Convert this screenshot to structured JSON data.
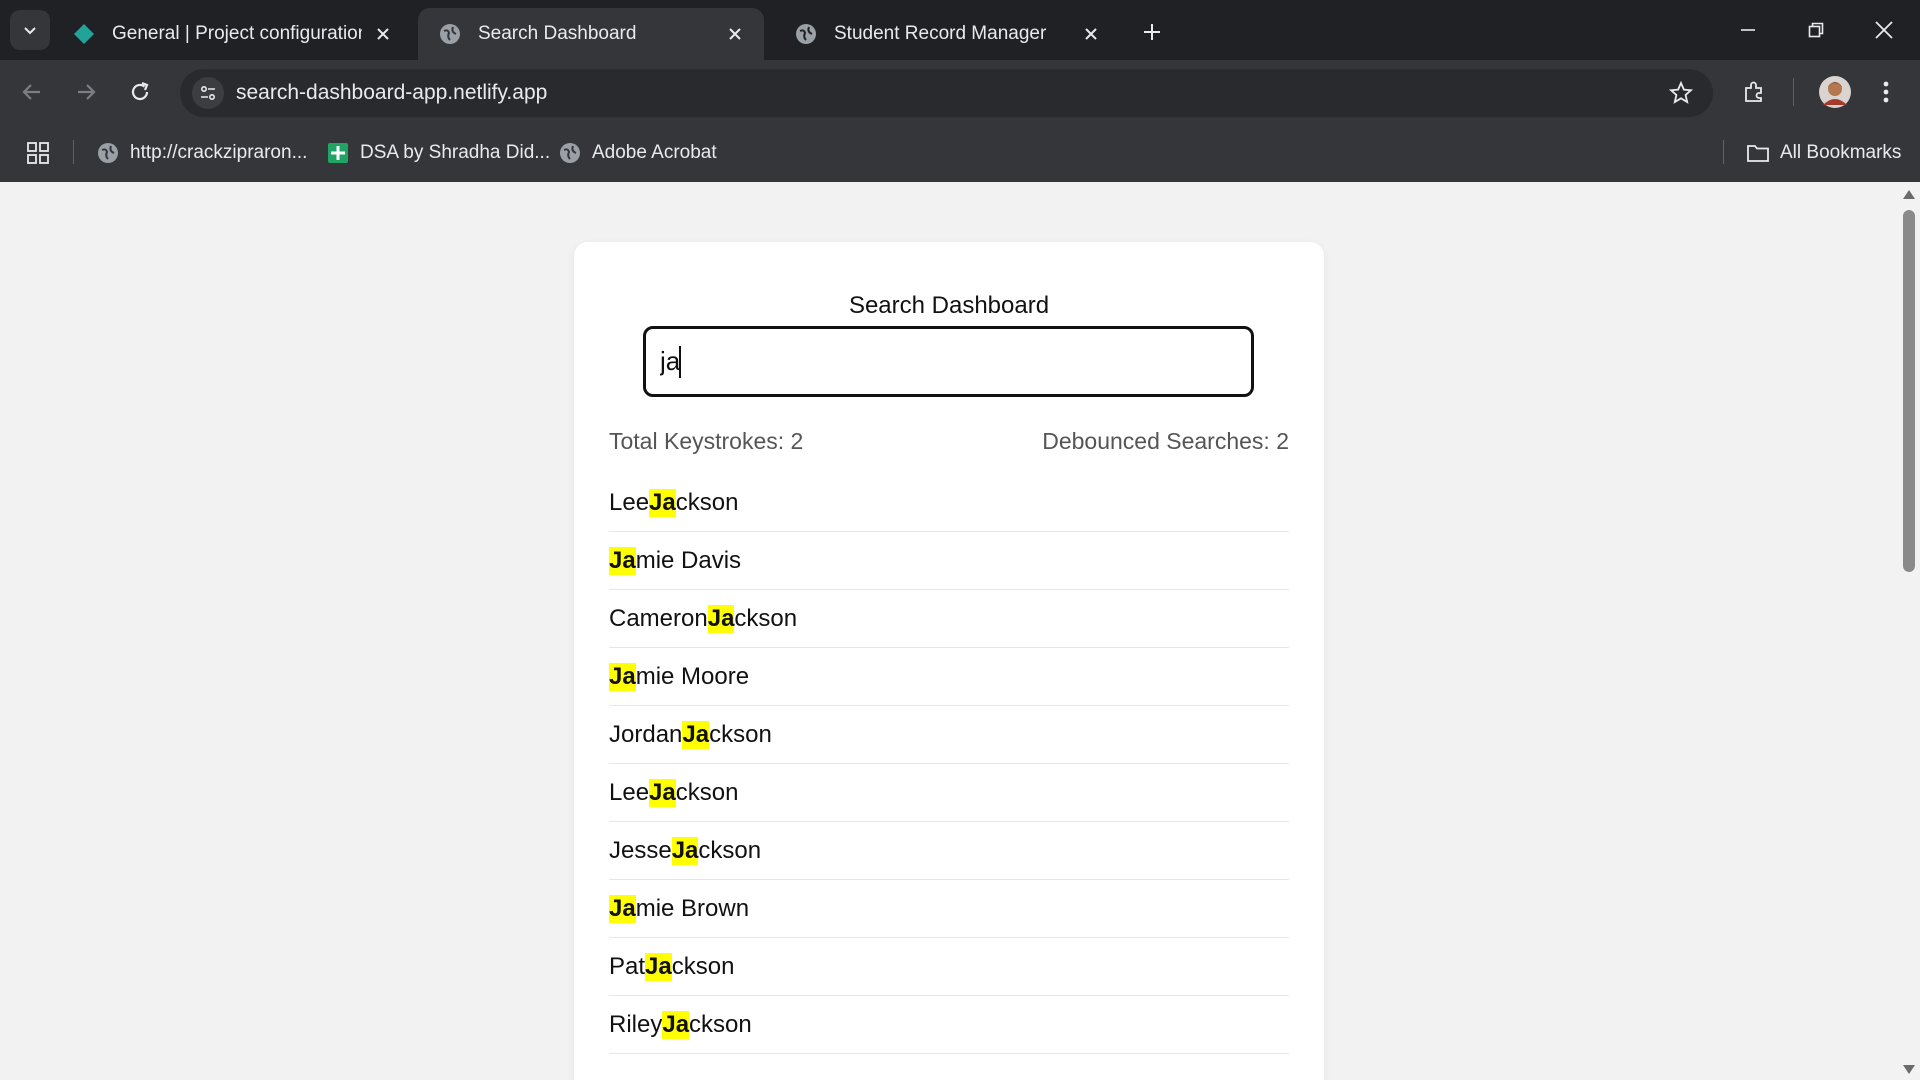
{
  "browser": {
    "tabs": [
      {
        "title": "General | Project configuration |",
        "active": false,
        "icon": "diamond-icon"
      },
      {
        "title": "Search Dashboard",
        "active": true,
        "icon": "globe-icon"
      },
      {
        "title": "Student Record Manager",
        "active": false,
        "icon": "globe-icon"
      }
    ],
    "url": "search-dashboard-app.netlify.app",
    "bookmarks": [
      {
        "label": "http://crackzipraron...",
        "icon": "globe-icon"
      },
      {
        "label": "DSA by Shradha Did...",
        "icon": "green-plus-icon"
      },
      {
        "label": "Adobe Acrobat",
        "icon": "globe-icon"
      }
    ],
    "all_bookmarks": "All Bookmarks"
  },
  "dashboard": {
    "title": "Search Dashboard",
    "query": "ja",
    "stats": {
      "keystrokes_label": "Total Keystrokes: 2",
      "searches_label": "Debounced Searches: 2"
    },
    "highlight_color": "#ffff00",
    "results": [
      {
        "pre": "Lee ",
        "match": "Ja",
        "post": "ckson"
      },
      {
        "pre": "",
        "match": "Ja",
        "post": "mie Davis"
      },
      {
        "pre": "Cameron ",
        "match": "Ja",
        "post": "ckson"
      },
      {
        "pre": "",
        "match": "Ja",
        "post": "mie Moore"
      },
      {
        "pre": "Jordan ",
        "match": "Ja",
        "post": "ckson"
      },
      {
        "pre": "Lee ",
        "match": "Ja",
        "post": "ckson"
      },
      {
        "pre": "Jesse ",
        "match": "Ja",
        "post": "ckson"
      },
      {
        "pre": "",
        "match": "Ja",
        "post": "mie Brown"
      },
      {
        "pre": "Pat ",
        "match": "Ja",
        "post": "ckson"
      },
      {
        "pre": "Riley ",
        "match": "Ja",
        "post": "ckson"
      }
    ]
  }
}
